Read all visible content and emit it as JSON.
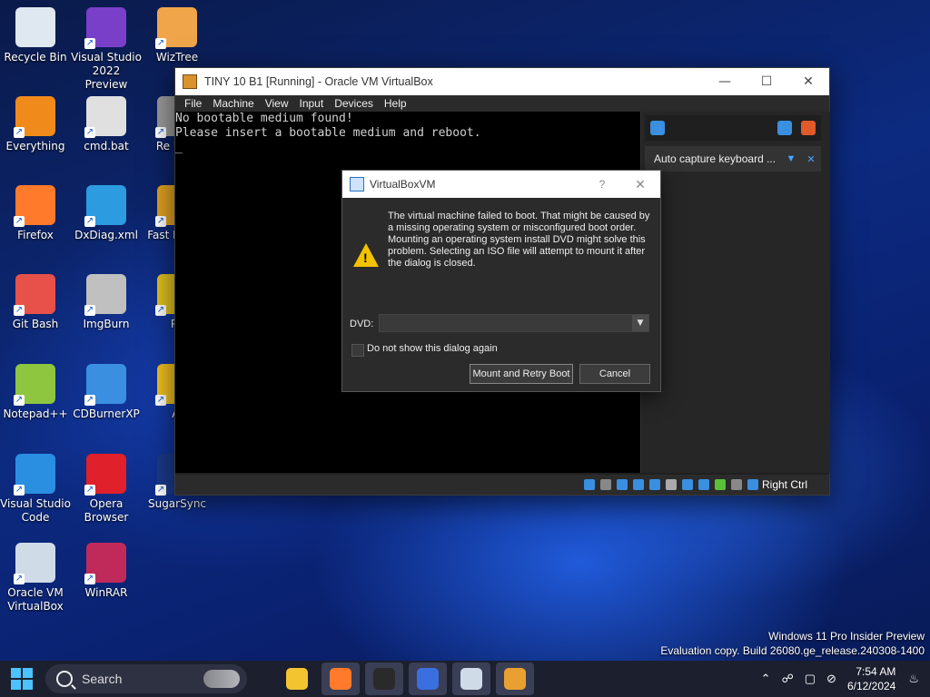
{
  "desktop_icons": [
    {
      "label": "Recycle Bin",
      "icon": "recycle-bin-icon",
      "color": "#dfe8f0"
    },
    {
      "label": "Visual Studio 2022 Preview",
      "icon": "visual-studio-preview-icon",
      "color": "#7a3fc9"
    },
    {
      "label": "WizTree",
      "icon": "wiztree-icon",
      "color": "#f1a54a"
    },
    {
      "label": "Everything",
      "icon": "everything-icon",
      "color": "#f08a1a"
    },
    {
      "label": "cmd.bat",
      "icon": "cmd-bat-icon",
      "color": "#e0e0e0"
    },
    {
      "label": "Re Unin",
      "icon": "revo-uninstaller-icon",
      "color": "#9a9a9a"
    },
    {
      "label": "Firefox",
      "icon": "firefox-icon",
      "color": "#ff7a2a"
    },
    {
      "label": "DxDiag.xml",
      "icon": "edge-icon",
      "color": "#2c9be0"
    },
    {
      "label": "Fast Image",
      "icon": "faststone-icon",
      "color": "#e0a020"
    },
    {
      "label": "Git Bash",
      "icon": "git-bash-icon",
      "color": "#e8504a"
    },
    {
      "label": "ImgBurn",
      "icon": "imgburn-icon",
      "color": "#c0c0c0"
    },
    {
      "label": "Pe",
      "icon": "pe-icon",
      "color": "#e0c020"
    },
    {
      "label": "Notepad++",
      "icon": "notepad-plus-plus-icon",
      "color": "#8ec640"
    },
    {
      "label": "CDBurnerXP",
      "icon": "cdburnerxp-icon",
      "color": "#3a8fe0"
    },
    {
      "label": "Al",
      "icon": "al-icon",
      "color": "#f0c020"
    },
    {
      "label": "Visual Studio Code",
      "icon": "vscode-icon",
      "color": "#2a8fe0"
    },
    {
      "label": "Opera Browser",
      "icon": "opera-icon",
      "color": "#e0202a"
    },
    {
      "label": "SugarSync",
      "icon": "sugarsync-icon",
      "color": "#1a3a8a"
    },
    {
      "label": "Oracle VM VirtualBox",
      "icon": "virtualbox-icon",
      "color": "#d0dbe8"
    },
    {
      "label": "WinRAR",
      "icon": "winrar-icon",
      "color": "#c02a5a"
    }
  ],
  "vbox_window": {
    "title": "TINY 10 B1 [Running] - Oracle VM VirtualBox",
    "menu": [
      "File",
      "Machine",
      "View",
      "Input",
      "Devices",
      "Help"
    ],
    "console_lines": [
      "No bootable medium found!",
      "Please insert a bootable medium and reboot.",
      "_"
    ],
    "side_panel_row": "Auto capture keyboard ...",
    "host_key": "Right Ctrl"
  },
  "dialog": {
    "title": "VirtualBoxVM",
    "help": "?",
    "message": "The virtual machine failed to boot. That might be caused by a missing operating system or misconfigured boot order. Mounting an operating system install DVD might solve this problem. Selecting an ISO file will attempt to mount it after the dialog is closed.",
    "dvd_label": "DVD:",
    "dvd_value": "",
    "checkbox_label": "Do not show this dialog again",
    "checkbox_checked": false,
    "primary_button": "Mount and Retry Boot",
    "cancel_button": "Cancel"
  },
  "watermark": {
    "line1": "Windows 11 Pro Insider Preview",
    "line2": "Evaluation copy. Build 26080.ge_release.240308-1400"
  },
  "taskbar": {
    "search_label": "Search",
    "apps": [
      {
        "icon": "file-explorer-icon",
        "color": "#f4c430",
        "selected": false
      },
      {
        "icon": "firefox-icon",
        "color": "#ff7a2a",
        "selected": true
      },
      {
        "icon": "obs-icon",
        "color": "#2a2a2a",
        "selected": true
      },
      {
        "icon": "app-blue-icon",
        "color": "#3a6fe0",
        "selected": true
      },
      {
        "icon": "virtualbox-icon",
        "color": "#d0dbe8",
        "selected": true
      },
      {
        "icon": "wiztree-icon",
        "color": "#e8a030",
        "selected": true
      }
    ],
    "time": "7:54 AM",
    "date": "6/12/2024"
  }
}
